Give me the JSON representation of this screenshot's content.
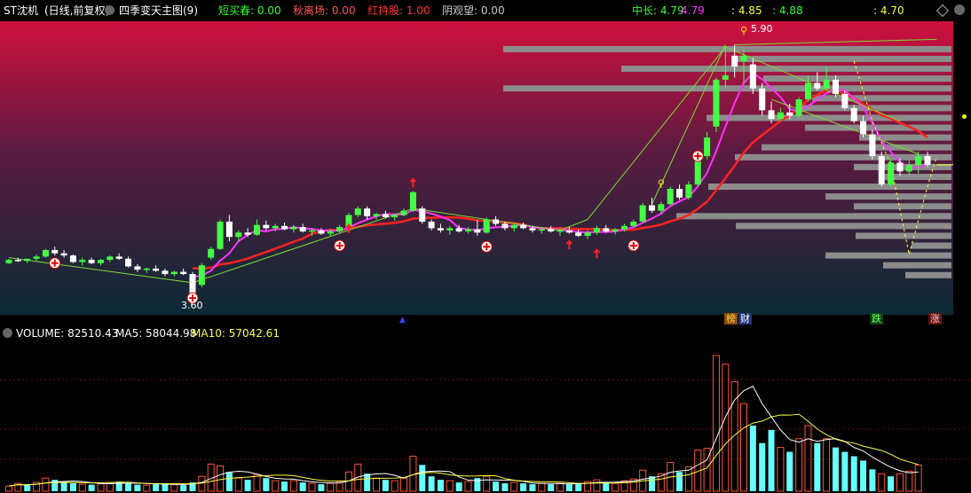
{
  "header": {
    "stock": "ST沈机",
    "mode": "(日线,前复权)",
    "indicator": "四季变天主图(9)",
    "items": [
      {
        "label": "短买春: 0.00",
        "color": "#33ff33"
      },
      {
        "label": "秋离场: 0.00",
        "color": "#ff5555"
      },
      {
        "label": "红持股: 1.00",
        "color": "#ff3333"
      },
      {
        "label": "阴观望: 0.00",
        "color": "#cccccc"
      }
    ],
    "right_items": [
      {
        "label": "中长: 4.79",
        "color": "#33ff33"
      },
      {
        "label": "4.79",
        "color": "#ff33ff"
      },
      {
        "label": ": 4.85",
        "color": "#ffff33"
      },
      {
        "label": ": 4.88",
        "color": "#33ff33"
      },
      {
        "label": ": 4.70",
        "color": "#ffff33"
      }
    ]
  },
  "price_labels": {
    "high": "5.90",
    "low": "3.60"
  },
  "bottom_tags": {
    "bang": "榜",
    "cai": "财",
    "die": "跌",
    "zhang": "涨"
  },
  "volume_header": {
    "volume": "VOLUME: 82510.43",
    "ma5": "MA5: 58044.98",
    "ma10": "MA10: 57042.61"
  },
  "colors": {
    "up": "#44ff44",
    "down": "#ffffff",
    "ma_red": "#ff2222",
    "ma_magenta": "#ff33ff",
    "vol_up": "#ff5533",
    "vol_down": "#66ffff",
    "ma5": "#ffffff",
    "ma10": "#ffff44"
  },
  "chart_data": {
    "type": "candlestick",
    "ylim": [
      3.5,
      6.05
    ],
    "candles": [
      [
        3.9,
        3.94,
        3.89,
        3.93
      ],
      [
        3.93,
        3.95,
        3.91,
        3.92
      ],
      [
        3.92,
        3.94,
        3.9,
        3.94
      ],
      [
        3.94,
        3.98,
        3.92,
        3.96
      ],
      [
        3.96,
        4.03,
        3.95,
        4.02
      ],
      [
        4.02,
        4.05,
        3.97,
        3.99
      ],
      [
        3.99,
        4.02,
        3.95,
        3.97
      ],
      [
        3.97,
        3.98,
        3.9,
        3.91
      ],
      [
        3.91,
        3.95,
        3.88,
        3.93
      ],
      [
        3.93,
        3.95,
        3.89,
        3.9
      ],
      [
        3.9,
        3.94,
        3.88,
        3.93
      ],
      [
        3.93,
        3.97,
        3.91,
        3.96
      ],
      [
        3.96,
        3.99,
        3.93,
        3.94
      ],
      [
        3.94,
        3.96,
        3.86,
        3.87
      ],
      [
        3.87,
        3.89,
        3.82,
        3.84
      ],
      [
        3.84,
        3.86,
        3.81,
        3.85
      ],
      [
        3.85,
        3.88,
        3.82,
        3.83
      ],
      [
        3.83,
        3.85,
        3.78,
        3.8
      ],
      [
        3.8,
        3.83,
        3.78,
        3.82
      ],
      [
        3.82,
        3.85,
        3.79,
        3.8
      ],
      [
        3.8,
        3.82,
        3.6,
        3.62
      ],
      [
        3.7,
        3.9,
        3.68,
        3.88
      ],
      [
        3.95,
        4.05,
        3.93,
        4.03
      ],
      [
        4.03,
        4.3,
        4.02,
        4.28
      ],
      [
        4.28,
        4.34,
        4.1,
        4.14
      ],
      [
        4.14,
        4.2,
        4.1,
        4.18
      ],
      [
        4.18,
        4.22,
        4.14,
        4.16
      ],
      [
        4.16,
        4.3,
        4.15,
        4.25
      ],
      [
        4.25,
        4.29,
        4.2,
        4.22
      ],
      [
        4.22,
        4.26,
        4.19,
        4.24
      ],
      [
        4.24,
        4.27,
        4.2,
        4.21
      ],
      [
        4.21,
        4.25,
        4.18,
        4.23
      ],
      [
        4.23,
        4.26,
        4.18,
        4.19
      ],
      [
        4.19,
        4.22,
        4.15,
        4.2
      ],
      [
        4.2,
        4.22,
        4.16,
        4.17
      ],
      [
        4.17,
        4.21,
        4.15,
        4.19
      ],
      [
        4.19,
        4.25,
        4.17,
        4.23
      ],
      [
        4.23,
        4.36,
        4.22,
        4.34
      ],
      [
        4.34,
        4.42,
        4.32,
        4.4
      ],
      [
        4.4,
        4.42,
        4.3,
        4.33
      ],
      [
        4.33,
        4.36,
        4.3,
        4.35
      ],
      [
        4.35,
        4.38,
        4.31,
        4.32
      ],
      [
        4.32,
        4.35,
        4.29,
        4.34
      ],
      [
        4.34,
        4.4,
        4.33,
        4.38
      ],
      [
        4.38,
        4.56,
        4.37,
        4.55
      ],
      [
        4.4,
        4.42,
        4.26,
        4.28
      ],
      [
        4.28,
        4.3,
        4.2,
        4.22
      ],
      [
        4.22,
        4.26,
        4.18,
        4.2
      ],
      [
        4.2,
        4.24,
        4.16,
        4.22
      ],
      [
        4.22,
        4.25,
        4.18,
        4.19
      ],
      [
        4.19,
        4.23,
        4.17,
        4.21
      ],
      [
        4.21,
        4.3,
        4.15,
        4.18
      ],
      [
        4.18,
        4.32,
        4.17,
        4.3
      ],
      [
        4.3,
        4.33,
        4.24,
        4.26
      ],
      [
        4.26,
        4.28,
        4.2,
        4.22
      ],
      [
        4.22,
        4.26,
        4.19,
        4.25
      ],
      [
        4.25,
        4.27,
        4.21,
        4.22
      ],
      [
        4.22,
        4.24,
        4.18,
        4.2
      ],
      [
        4.2,
        4.23,
        4.17,
        4.21
      ],
      [
        4.21,
        4.24,
        4.18,
        4.19
      ],
      [
        4.19,
        4.22,
        4.15,
        4.2
      ],
      [
        4.2,
        4.23,
        4.17,
        4.18
      ],
      [
        4.18,
        4.21,
        4.14,
        4.15
      ],
      [
        4.15,
        4.2,
        4.12,
        4.18
      ],
      [
        4.18,
        4.24,
        4.16,
        4.22
      ],
      [
        4.22,
        4.25,
        4.18,
        4.19
      ],
      [
        4.19,
        4.22,
        4.16,
        4.21
      ],
      [
        4.21,
        4.26,
        4.19,
        4.24
      ],
      [
        4.24,
        4.3,
        4.22,
        4.28
      ],
      [
        4.28,
        4.45,
        4.27,
        4.43
      ],
      [
        4.43,
        4.5,
        4.36,
        4.38
      ],
      [
        4.38,
        4.46,
        4.35,
        4.44
      ],
      [
        4.44,
        4.6,
        4.43,
        4.58
      ],
      [
        4.58,
        4.62,
        4.48,
        4.5
      ],
      [
        4.5,
        4.65,
        4.48,
        4.62
      ],
      [
        4.62,
        4.9,
        4.6,
        4.88
      ],
      [
        4.88,
        5.1,
        4.85,
        5.05
      ],
      [
        5.15,
        5.6,
        5.1,
        5.58
      ],
      [
        5.58,
        5.88,
        5.5,
        5.62
      ],
      [
        5.8,
        5.9,
        5.6,
        5.7
      ],
      [
        5.75,
        5.85,
        5.55,
        5.8
      ],
      [
        5.72,
        5.78,
        5.45,
        5.5
      ],
      [
        5.5,
        5.55,
        5.25,
        5.3
      ],
      [
        5.3,
        5.38,
        5.18,
        5.22
      ],
      [
        5.22,
        5.32,
        5.2,
        5.28
      ],
      [
        5.28,
        5.36,
        5.22,
        5.25
      ],
      [
        5.25,
        5.42,
        5.23,
        5.4
      ],
      [
        5.4,
        5.62,
        5.38,
        5.55
      ],
      [
        5.55,
        5.65,
        5.48,
        5.5
      ],
      [
        5.5,
        5.7,
        5.48,
        5.58
      ],
      [
        5.58,
        5.62,
        5.42,
        5.45
      ],
      [
        5.45,
        5.48,
        5.3,
        5.32
      ],
      [
        5.32,
        5.35,
        5.18,
        5.2
      ],
      [
        5.2,
        5.25,
        5.05,
        5.08
      ],
      [
        5.08,
        5.12,
        4.85,
        4.88
      ],
      [
        4.88,
        4.92,
        4.6,
        4.62
      ],
      [
        4.62,
        4.85,
        4.6,
        4.82
      ],
      [
        4.82,
        4.86,
        4.7,
        4.74
      ],
      [
        4.74,
        4.84,
        4.7,
        4.8
      ],
      [
        4.8,
        4.92,
        4.72,
        4.88
      ],
      [
        4.88,
        4.92,
        4.78,
        4.8
      ]
    ],
    "vol_profile": [
      {
        "price": 5.86,
        "len": 505
      },
      {
        "price": 5.77,
        "len": 242
      },
      {
        "price": 5.68,
        "len": 372
      },
      {
        "price": 5.59,
        "len": 212
      },
      {
        "price": 5.5,
        "len": 505
      },
      {
        "price": 5.41,
        "len": 157
      },
      {
        "price": 5.32,
        "len": 175
      },
      {
        "price": 5.23,
        "len": 276
      },
      {
        "price": 5.14,
        "len": 165
      },
      {
        "price": 5.05,
        "len": 104
      },
      {
        "price": 4.96,
        "len": 214
      },
      {
        "price": 4.87,
        "len": 244
      },
      {
        "price": 4.78,
        "len": 110
      },
      {
        "price": 4.69,
        "len": 75
      },
      {
        "price": 4.6,
        "len": 274
      },
      {
        "price": 4.51,
        "len": 142
      },
      {
        "price": 4.42,
        "len": 110
      },
      {
        "price": 4.33,
        "len": 310
      },
      {
        "price": 4.24,
        "len": 243
      },
      {
        "price": 4.15,
        "len": 108
      },
      {
        "price": 4.06,
        "len": 45
      },
      {
        "price": 3.97,
        "len": 142
      },
      {
        "price": 3.88,
        "len": 77
      },
      {
        "price": 3.79,
        "len": 52
      }
    ],
    "volumes": [
      [
        12,
        0
      ],
      [
        18,
        0
      ],
      [
        14,
        1
      ],
      [
        20,
        0
      ],
      [
        30,
        0
      ],
      [
        26,
        1
      ],
      [
        22,
        1
      ],
      [
        18,
        1
      ],
      [
        16,
        0
      ],
      [
        15,
        1
      ],
      [
        17,
        0
      ],
      [
        20,
        0
      ],
      [
        22,
        1
      ],
      [
        18,
        1
      ],
      [
        15,
        1
      ],
      [
        14,
        0
      ],
      [
        16,
        1
      ],
      [
        18,
        1
      ],
      [
        15,
        0
      ],
      [
        14,
        1
      ],
      [
        20,
        1
      ],
      [
        34,
        0
      ],
      [
        62,
        0
      ],
      [
        58,
        0
      ],
      [
        44,
        1
      ],
      [
        30,
        0
      ],
      [
        26,
        1
      ],
      [
        38,
        0
      ],
      [
        30,
        1
      ],
      [
        24,
        0
      ],
      [
        22,
        1
      ],
      [
        24,
        0
      ],
      [
        20,
        1
      ],
      [
        18,
        0
      ],
      [
        16,
        1
      ],
      [
        18,
        0
      ],
      [
        22,
        0
      ],
      [
        44,
        0
      ],
      [
        62,
        0
      ],
      [
        40,
        1
      ],
      [
        30,
        0
      ],
      [
        26,
        1
      ],
      [
        24,
        0
      ],
      [
        30,
        0
      ],
      [
        80,
        0
      ],
      [
        60,
        1
      ],
      [
        34,
        1
      ],
      [
        26,
        1
      ],
      [
        24,
        0
      ],
      [
        20,
        1
      ],
      [
        22,
        0
      ],
      [
        30,
        1
      ],
      [
        34,
        0
      ],
      [
        22,
        1
      ],
      [
        18,
        1
      ],
      [
        20,
        0
      ],
      [
        18,
        1
      ],
      [
        16,
        1
      ],
      [
        18,
        0
      ],
      [
        16,
        1
      ],
      [
        18,
        0
      ],
      [
        16,
        1
      ],
      [
        18,
        1
      ],
      [
        22,
        0
      ],
      [
        26,
        0
      ],
      [
        20,
        1
      ],
      [
        18,
        0
      ],
      [
        24,
        0
      ],
      [
        28,
        0
      ],
      [
        48,
        0
      ],
      [
        34,
        1
      ],
      [
        40,
        0
      ],
      [
        66,
        0
      ],
      [
        44,
        1
      ],
      [
        56,
        0
      ],
      [
        94,
        0
      ],
      [
        98,
        0
      ],
      [
        310,
        0
      ],
      [
        290,
        0
      ],
      [
        250,
        0
      ],
      [
        200,
        0
      ],
      [
        150,
        1
      ],
      [
        110,
        1
      ],
      [
        140,
        1
      ],
      [
        100,
        0
      ],
      [
        90,
        1
      ],
      [
        120,
        0
      ],
      [
        150,
        0
      ],
      [
        110,
        1
      ],
      [
        120,
        0
      ],
      [
        100,
        1
      ],
      [
        90,
        1
      ],
      [
        80,
        1
      ],
      [
        70,
        1
      ],
      [
        50,
        1
      ],
      [
        40,
        0
      ],
      [
        34,
        1
      ],
      [
        40,
        0
      ],
      [
        46,
        0
      ],
      [
        60,
        0
      ]
    ]
  }
}
